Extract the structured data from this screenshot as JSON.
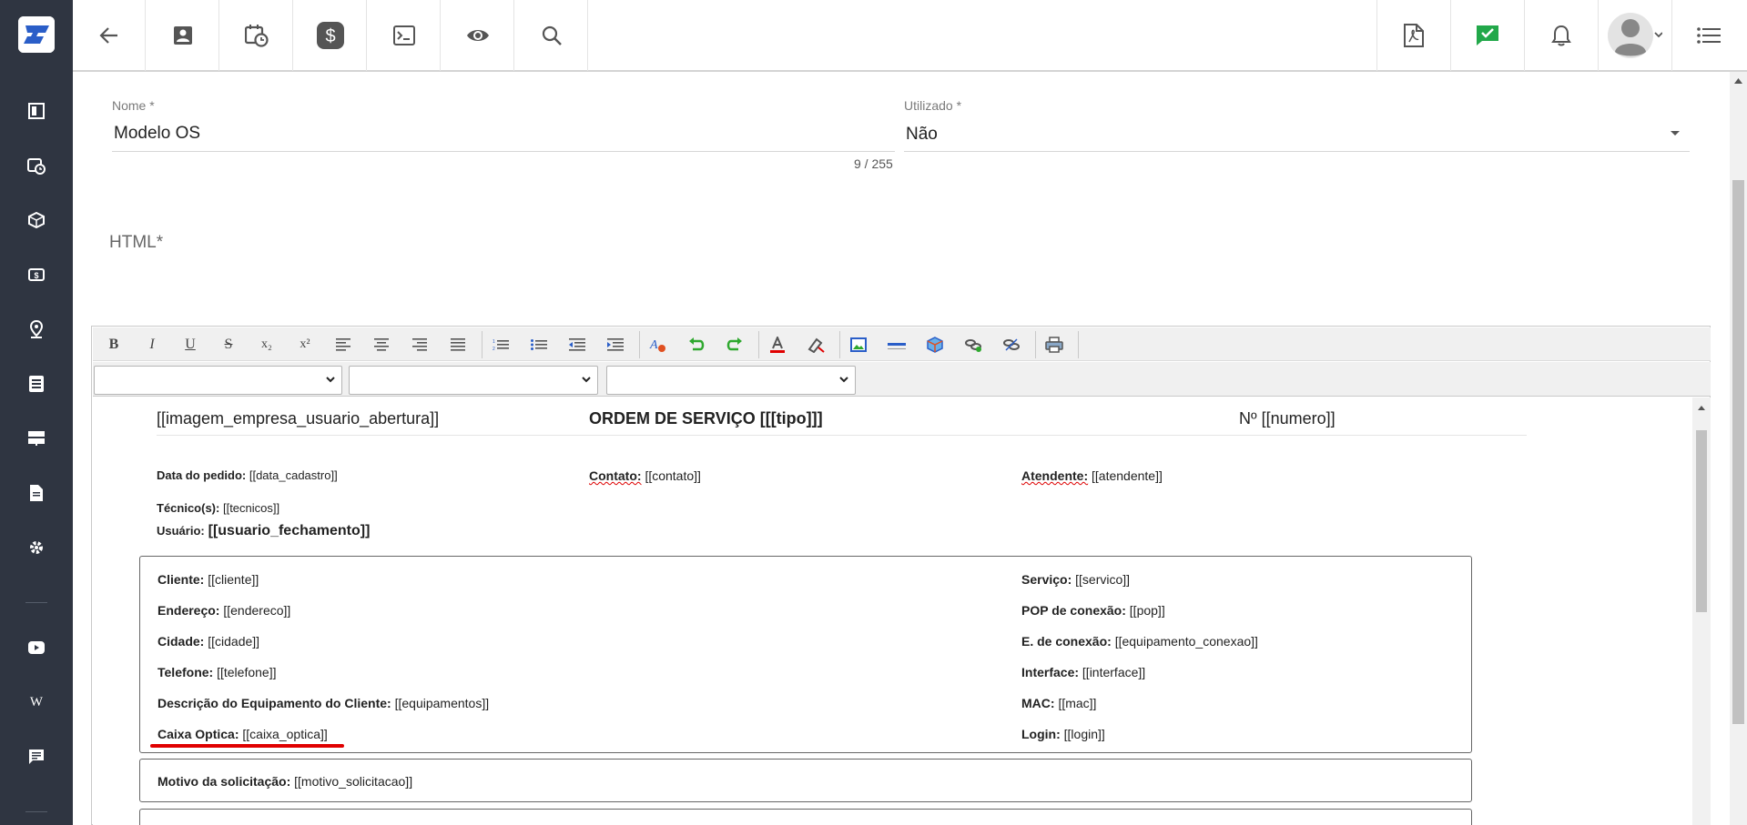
{
  "sidebar": {
    "items": [
      {
        "icon": "dashboard-icon"
      },
      {
        "icon": "calendar-clock-icon"
      },
      {
        "icon": "box-icon"
      },
      {
        "icon": "money-icon"
      },
      {
        "icon": "map-pin-icon"
      },
      {
        "icon": "list-icon"
      },
      {
        "icon": "server-icon"
      },
      {
        "icon": "document-icon"
      },
      {
        "icon": "gear-icon"
      },
      {
        "icon": "youtube-icon"
      },
      {
        "icon": "wikipedia-icon"
      },
      {
        "icon": "chat-icon"
      }
    ]
  },
  "topbar": {
    "left": [
      "back-icon",
      "contact-card-icon",
      "calendar-clock-icon",
      "dollar-icon",
      "terminal-icon",
      "eye-icon",
      "search-icon"
    ],
    "right": [
      "pdf-icon",
      "check-chat-icon",
      "bell-icon",
      "avatar",
      "menu-list-icon"
    ]
  },
  "form": {
    "nome_label": "Nome *",
    "nome_value": "Modelo OS",
    "nome_counter": "9 / 255",
    "utilizado_label": "Utilizado *",
    "utilizado_value": "Não",
    "html_label": "HTML*"
  },
  "editor": {
    "toolbar": [
      "B",
      "I",
      "U",
      "S",
      "x₂",
      "x²"
    ],
    "selects": [
      "",
      "",
      ""
    ]
  },
  "doc": {
    "header_left": "[[imagem_empresa_usuario_abertura]]",
    "header_center": "ORDEM DE SERVIÇO [[[tipo]]]",
    "header_right": "Nº [[numero]]",
    "data_pedido_label": "Data do pedido:",
    "data_pedido_value": "[[data_cadastro]]",
    "contato_label": "Contato:",
    "contato_value": "[[contato]]",
    "atendente_label": "Atendente:",
    "atendente_value": "[[atendente]]",
    "tecnicos_label": "Técnico(s):",
    "tecnicos_value": "[[tecnicos]]",
    "usuario_label": "Usuário:",
    "usuario_value": "[[usuario_fechamento]]",
    "left_fields": [
      {
        "label": "Cliente:",
        "value": "[[cliente]]"
      },
      {
        "label": "Endereço:",
        "value": "[[endereco]]"
      },
      {
        "label": "Cidade:",
        "value": "[[cidade]]"
      },
      {
        "label": "Telefone:",
        "value": "[[telefone]]"
      },
      {
        "label": "Descrição do Equipamento do Cliente:",
        "value": "[[equipamentos]]"
      },
      {
        "label": "Caixa Optica:",
        "value": "[[caixa_optica]]"
      }
    ],
    "right_fields": [
      {
        "label": "Serviço:",
        "value": "[[servico]]"
      },
      {
        "label": "POP de conexão:",
        "value": "[[pop]]"
      },
      {
        "label": "E. de conexão:",
        "value": "[[equipamento_conexao]]"
      },
      {
        "label": "Interface:",
        "value": "[[interface]]"
      },
      {
        "label": "MAC:",
        "value": "[[mac]]"
      },
      {
        "label": "Login:",
        "value": "[[login]]"
      }
    ],
    "motivo_label": "Motivo da solicitação:",
    "motivo_value": "[[motivo_solicitacao]]"
  },
  "colors": {
    "sidebar_bg": "#2f3541",
    "accent_blue": "#2a5ec8",
    "check_green": "#22a84a",
    "highlight_red": "#e00000"
  }
}
